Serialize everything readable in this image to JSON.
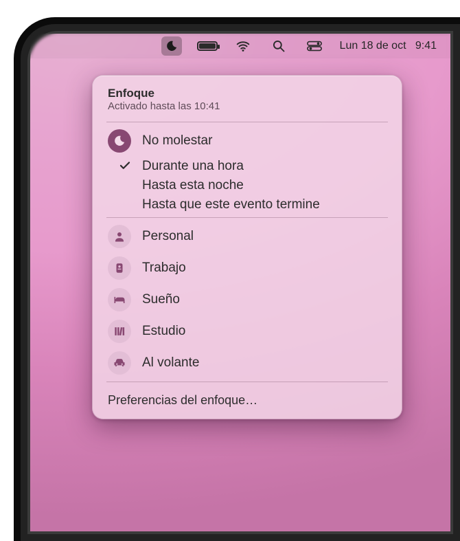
{
  "menubar": {
    "date": "Lun 18 de oct",
    "time": "9:41"
  },
  "panel": {
    "title": "Enfoque",
    "subtitle": "Activado hasta las 10:41",
    "active": {
      "label": "No molestar"
    },
    "durations": [
      {
        "label": "Durante una hora",
        "checked": true
      },
      {
        "label": "Hasta esta noche",
        "checked": false
      },
      {
        "label": "Hasta que este evento termine",
        "checked": false
      }
    ],
    "modes": [
      {
        "label": "Personal",
        "icon": "person"
      },
      {
        "label": "Trabajo",
        "icon": "badge"
      },
      {
        "label": "Sueño",
        "icon": "bed"
      },
      {
        "label": "Estudio",
        "icon": "books"
      },
      {
        "label": "Al volante",
        "icon": "car"
      }
    ],
    "prefs": "Preferencias del enfoque…"
  }
}
